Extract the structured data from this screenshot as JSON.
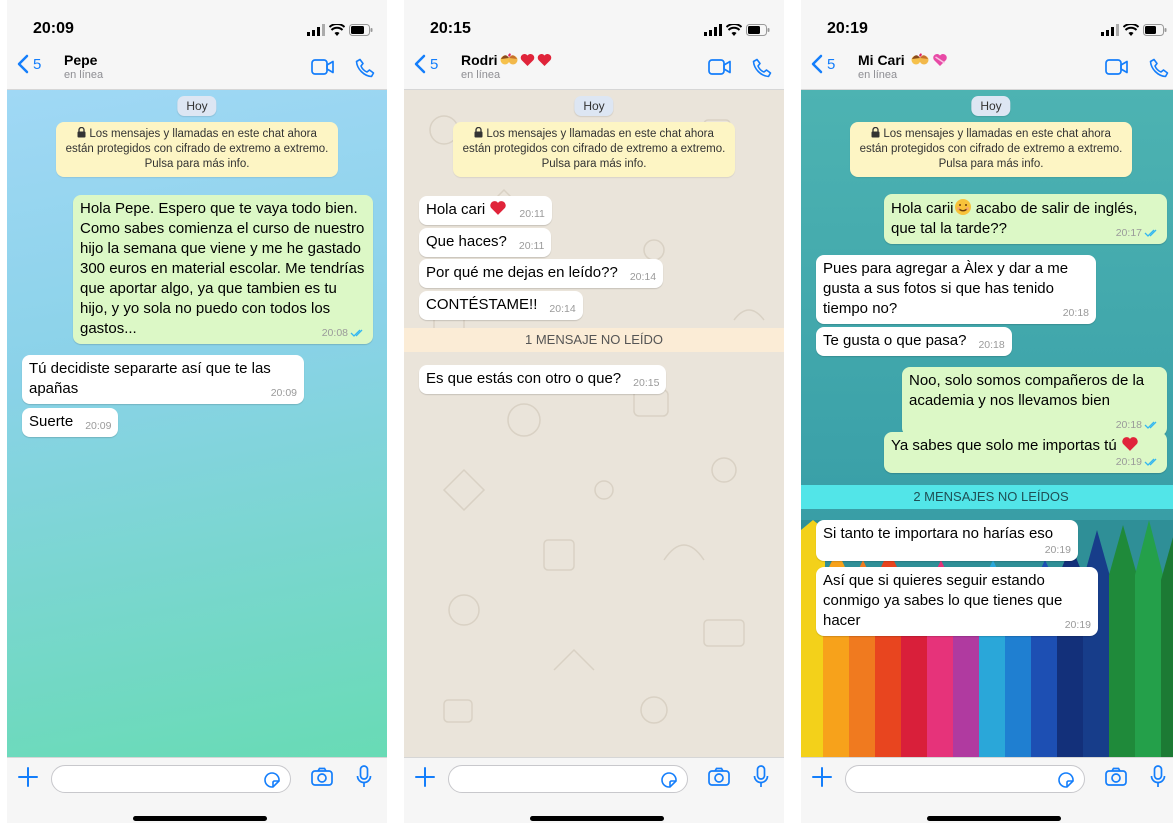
{
  "screens": [
    {
      "time": "20:09",
      "back_count": "5",
      "contact_name": "Pepe",
      "contact_status": "en línea",
      "day_label": "Hoy",
      "encryption_note": "Los mensajes y llamadas en este chat ahora están protegidos con cifrado de extremo a extremo. Pulsa para más info.",
      "messages": [
        {
          "direction": "out",
          "text": "Hola Pepe. Espero que te vaya todo bien. Como sabes comienza el curso de nuestro hijo la semana que viene y me he gastado 300 euros en material escolar. Me tendrías que aportar algo, ya que tambien es tu hijo, y yo sola no puedo con todos los gastos...",
          "time": "20:08",
          "read": true
        },
        {
          "direction": "in",
          "text": "Tú decidiste separarte así que te las apañas",
          "time": "20:09"
        },
        {
          "direction": "in",
          "text": "Suerte",
          "time": "20:09"
        }
      ],
      "wallpaper": "blue-green-gradient"
    },
    {
      "time": "20:15",
      "back_count": "5",
      "contact_name": "Rodri",
      "contact_status": "en línea",
      "day_label": "Hoy",
      "encryption_note": "Los mensajes y llamadas en este chat ahora están protegidos con cifrado de extremo a extremo. Pulsa para más info.",
      "messages": [
        {
          "direction": "in",
          "text": "Hola cari",
          "time": "20:11",
          "emoji": "red-heart"
        },
        {
          "direction": "in",
          "text": "Que haces?",
          "time": "20:11"
        },
        {
          "direction": "in",
          "text": "Por qué me dejas en leído??",
          "time": "20:14"
        },
        {
          "direction": "in",
          "text": "CONTÉSTAME!!",
          "time": "20:14"
        }
      ],
      "unread_label": "1 MENSAJE NO LEÍDO",
      "messages_after": [
        {
          "direction": "in",
          "text": "Es que estás con otro o que?",
          "time": "20:15"
        }
      ],
      "wallpaper": "beige-doodle"
    },
    {
      "time": "20:19",
      "back_count": "5",
      "contact_name": "Mi Cari",
      "contact_status": "en línea",
      "day_label": "Hoy",
      "encryption_note": "Los mensajes y llamadas en este chat ahora están protegidos con cifrado de extremo a extremo. Pulsa para más info.",
      "messages": [
        {
          "direction": "out",
          "text_before": "Hola carii",
          "text_after": " acabo de salir de inglés, que tal la tarde??",
          "time": "20:17",
          "read": true,
          "emoji": "smiling-face"
        },
        {
          "direction": "in",
          "text": "Pues para agregar a Àlex y dar a me gusta a sus fotos si que has tenido tiempo no?",
          "time": "20:18"
        },
        {
          "direction": "in",
          "text": "Te gusta o que pasa?",
          "time": "20:18"
        },
        {
          "direction": "out",
          "text": "Noo, solo somos compañeros de la academia y nos llevamos bien",
          "time": "20:18",
          "read": true
        },
        {
          "direction": "out",
          "text": "Ya sabes que solo me importas tú",
          "time": "20:19",
          "read": true,
          "emoji": "red-heart"
        }
      ],
      "unread_label": "2 MENSAJES NO LEÍDOS",
      "messages_after": [
        {
          "direction": "in",
          "text": "Si tanto te importara no harías eso",
          "time": "20:19"
        },
        {
          "direction": "in",
          "text": "Así que si quieres seguir estando conmigo ya sabes lo que tienes que hacer",
          "time": "20:19"
        }
      ],
      "wallpaper": "colored-pencils"
    }
  ],
  "colors": {
    "accent": "#147efb",
    "outgoing_bubble": "#dcf8c6",
    "incoming_bubble": "#ffffff",
    "read_ticks": "#34b7f1",
    "encryption_note_bg": "#fdf5c4"
  },
  "icons": {
    "back": "chevron-left-icon",
    "video": "video-camera-icon",
    "call": "phone-icon",
    "attach": "plus-icon",
    "sticker": "sticker-icon",
    "camera": "camera-icon",
    "mic": "microphone-icon"
  }
}
